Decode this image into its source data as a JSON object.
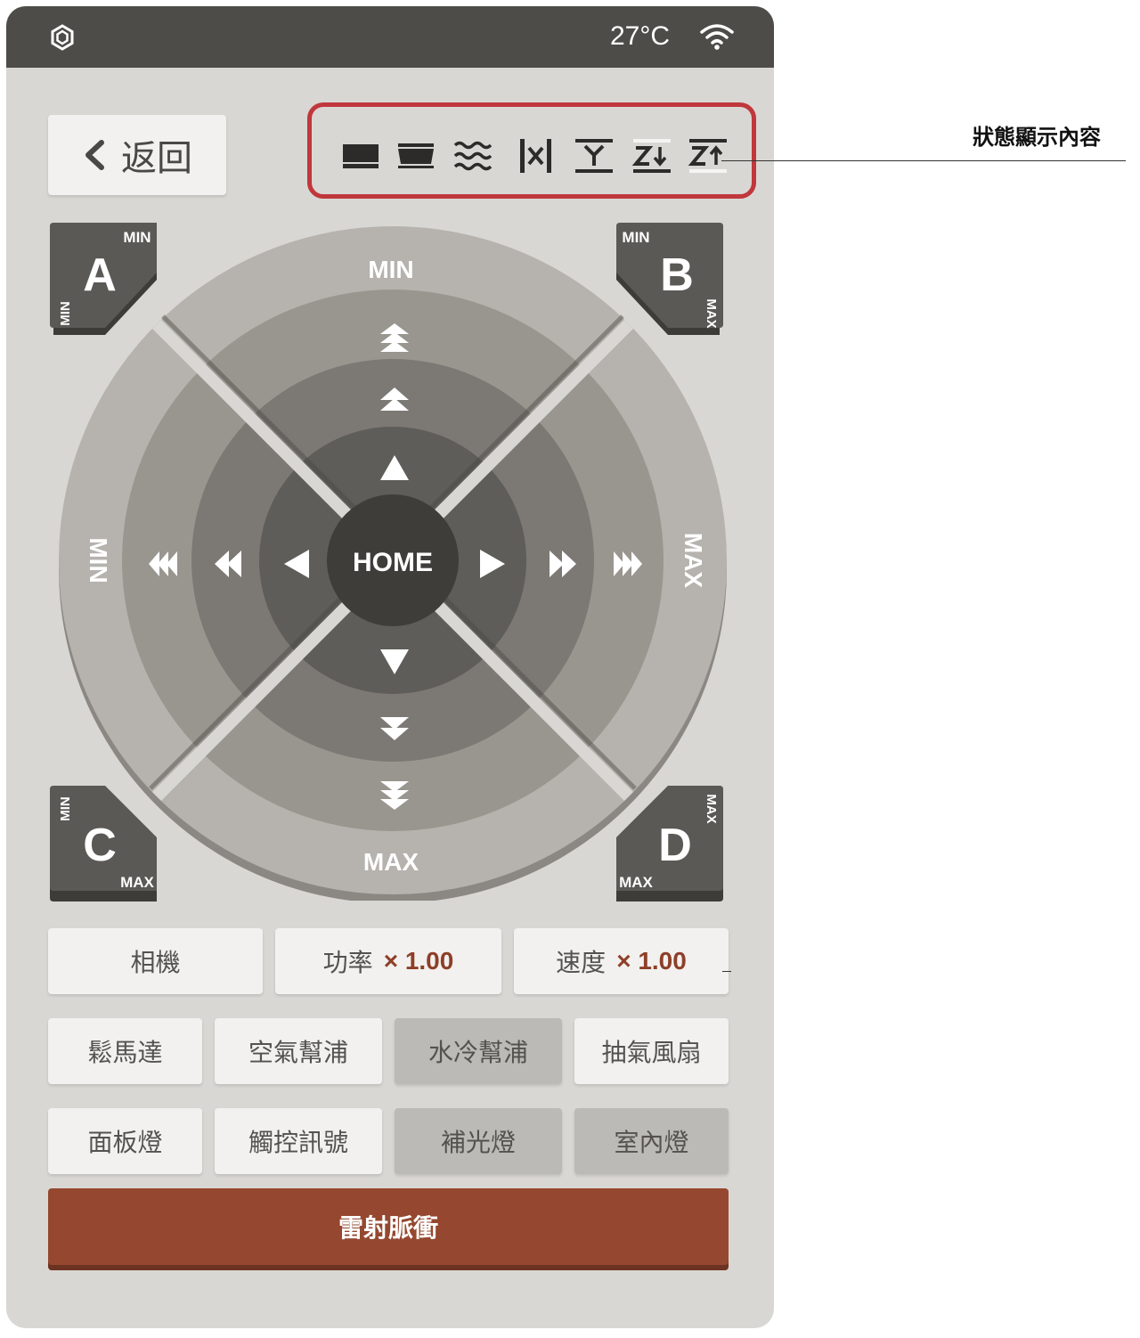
{
  "status_bar": {
    "temperature": "27°C",
    "logo_icon": "hexagon-logo-icon",
    "wifi_icon": "wifi-icon"
  },
  "back_button": {
    "label": "返回",
    "icon": "chevron-left-icon"
  },
  "status_icons": [
    "material-flat-icon",
    "material-tray-icon",
    "water-waves-icon",
    "x-limit-icon",
    "y-limit-icon",
    "z-down-icon",
    "z-up-icon"
  ],
  "annotation": "狀態顯示內容",
  "corners": {
    "a": {
      "letter": "A",
      "top_label": "MIN",
      "side_label": "MIN"
    },
    "b": {
      "letter": "B",
      "top_label": "MIN",
      "side_label": "MAX"
    },
    "c": {
      "letter": "C",
      "side_label": "MIN",
      "bottom_label": "MAX"
    },
    "d": {
      "letter": "D",
      "side_label": "MAX",
      "bottom_label": "MAX"
    }
  },
  "jog": {
    "top_label": "MIN",
    "bottom_label": "MAX",
    "left_label": "MIN",
    "right_label": "MAX",
    "home_label": "HOME"
  },
  "controls_row1": {
    "camera": "相機",
    "power_label": "功率",
    "power_value": "× 1.00",
    "speed_label": "速度",
    "speed_value": "× 1.00"
  },
  "controls_row2": [
    "鬆馬達",
    "空氣幫浦",
    "水冷幫浦",
    "抽氣風扇"
  ],
  "controls_row3": [
    "面板燈",
    "觸控訊號",
    "補光燈",
    "室內燈"
  ],
  "laser_button": "雷射脈衝",
  "colors": {
    "accent_red": "#c0373c",
    "laser_brown": "#95482f",
    "statusbar_dark": "#4e4c48",
    "device_bg": "#d9d7d3"
  }
}
